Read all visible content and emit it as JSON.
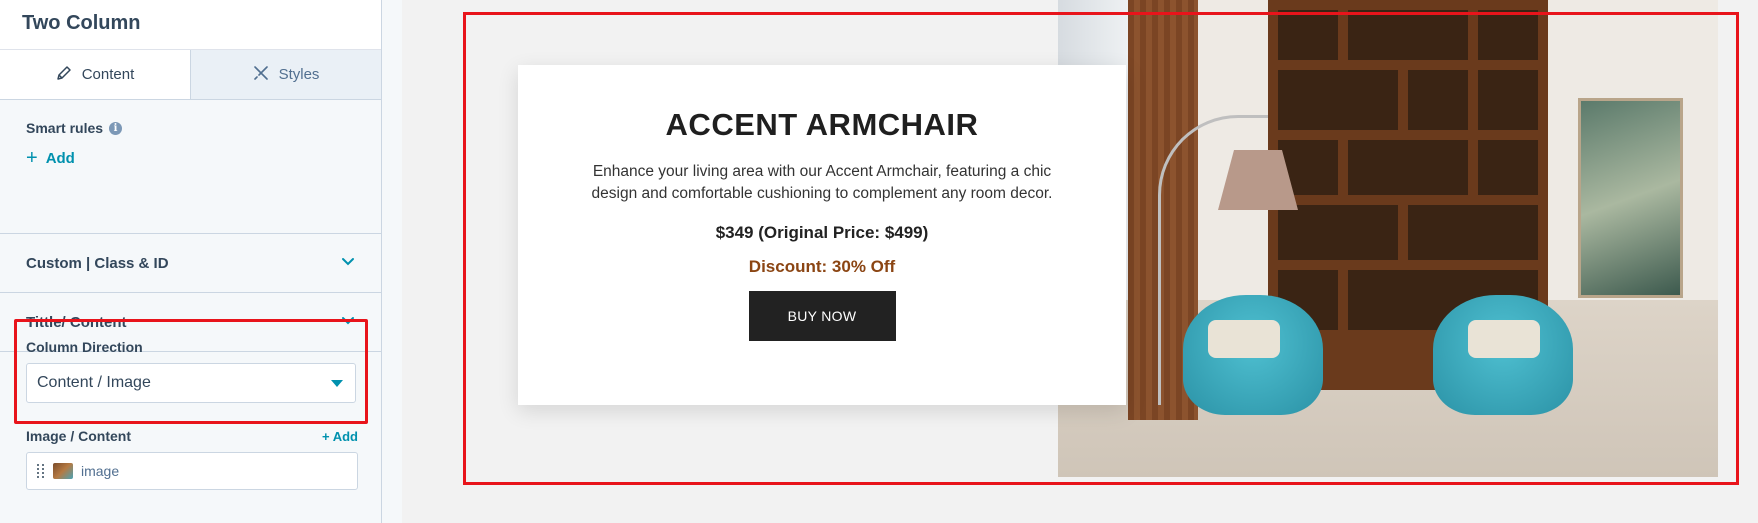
{
  "panel": {
    "title": "Two Column",
    "tabs": [
      {
        "label": "Content",
        "icon": "pencil-icon",
        "active": true
      },
      {
        "label": "Styles",
        "icon": "brush-icon",
        "active": false
      }
    ],
    "smart_rules": {
      "label": "Smart rules",
      "add_label": "Add"
    },
    "accordions": [
      {
        "label": "Custom | Class & ID"
      },
      {
        "label": "Tittle/ Content"
      }
    ],
    "column_direction": {
      "label": "Column Direction",
      "value": "Content / Image"
    },
    "image_content": {
      "label": "Image / Content",
      "add_label": "+ Add",
      "item_label": "image"
    }
  },
  "preview": {
    "title": "ACCENT ARMCHAIR",
    "description": "Enhance your living area with our Accent Armchair, featuring a chic design and comfortable cushioning to complement any room decor.",
    "price": "$349 (Original Price: $499)",
    "discount": "Discount: 30% Off",
    "button_label": "BUY NOW"
  },
  "colors": {
    "accent": "#0091ae",
    "highlight": "#e8141b",
    "discount": "#8b4513",
    "button": "#222222"
  }
}
